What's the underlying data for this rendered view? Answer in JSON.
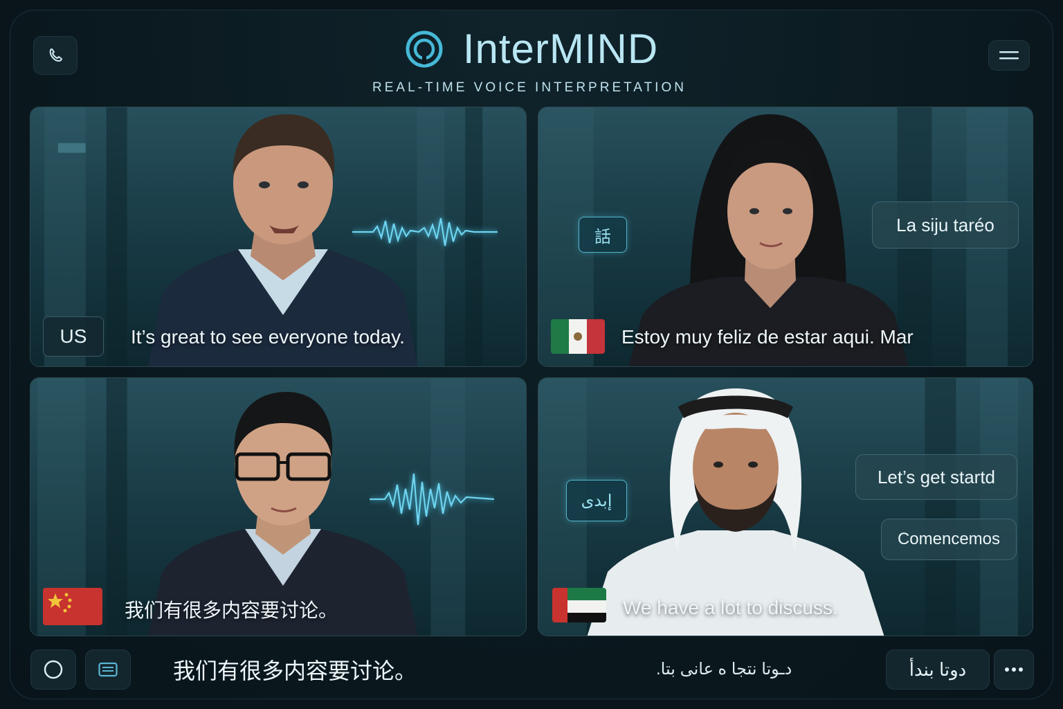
{
  "header": {
    "title": "InterMIND",
    "subtitle": "REAL-TIME VOICE INTERPRETATION",
    "left_icon": "phone-icon",
    "right_icon": "menu-icon"
  },
  "tiles": [
    {
      "speaker": "US male speaker",
      "lang_label": "US",
      "caption": "It’s great to see everyone today.",
      "indicator": "waveform"
    },
    {
      "speaker": "Mexican female speaker",
      "flag": "mexico-flag",
      "caption": "Estoy muy feliz de estar aqui.  Mar",
      "badge": "話",
      "bubble": "La siju taréo"
    },
    {
      "speaker": "Chinese male speaker",
      "flag": "china-flag",
      "caption": "我们有很多内容要讨论。",
      "indicator": "waveform"
    },
    {
      "speaker": "Emirati male speaker",
      "flag": "uae-flag",
      "caption": "We have a lot to discuss.",
      "badge": "إبدى",
      "bubbles": [
        "Let’s get startd",
        "Comencemos"
      ]
    }
  ],
  "bottom_bar": {
    "record_icon": "circle-icon",
    "chat_icon": "keyboard-icon",
    "transcript_cjk": "我们有很多内容要讨论。",
    "transcript_ar": "دـوتا نتجا ه عانى بتا.",
    "language_button": "دوتا بندأ",
    "more_icon": "more-icon"
  },
  "colors": {
    "accent": "#4fc3e0",
    "background": "#0a151b",
    "tile_bg": "#1b3f49"
  }
}
